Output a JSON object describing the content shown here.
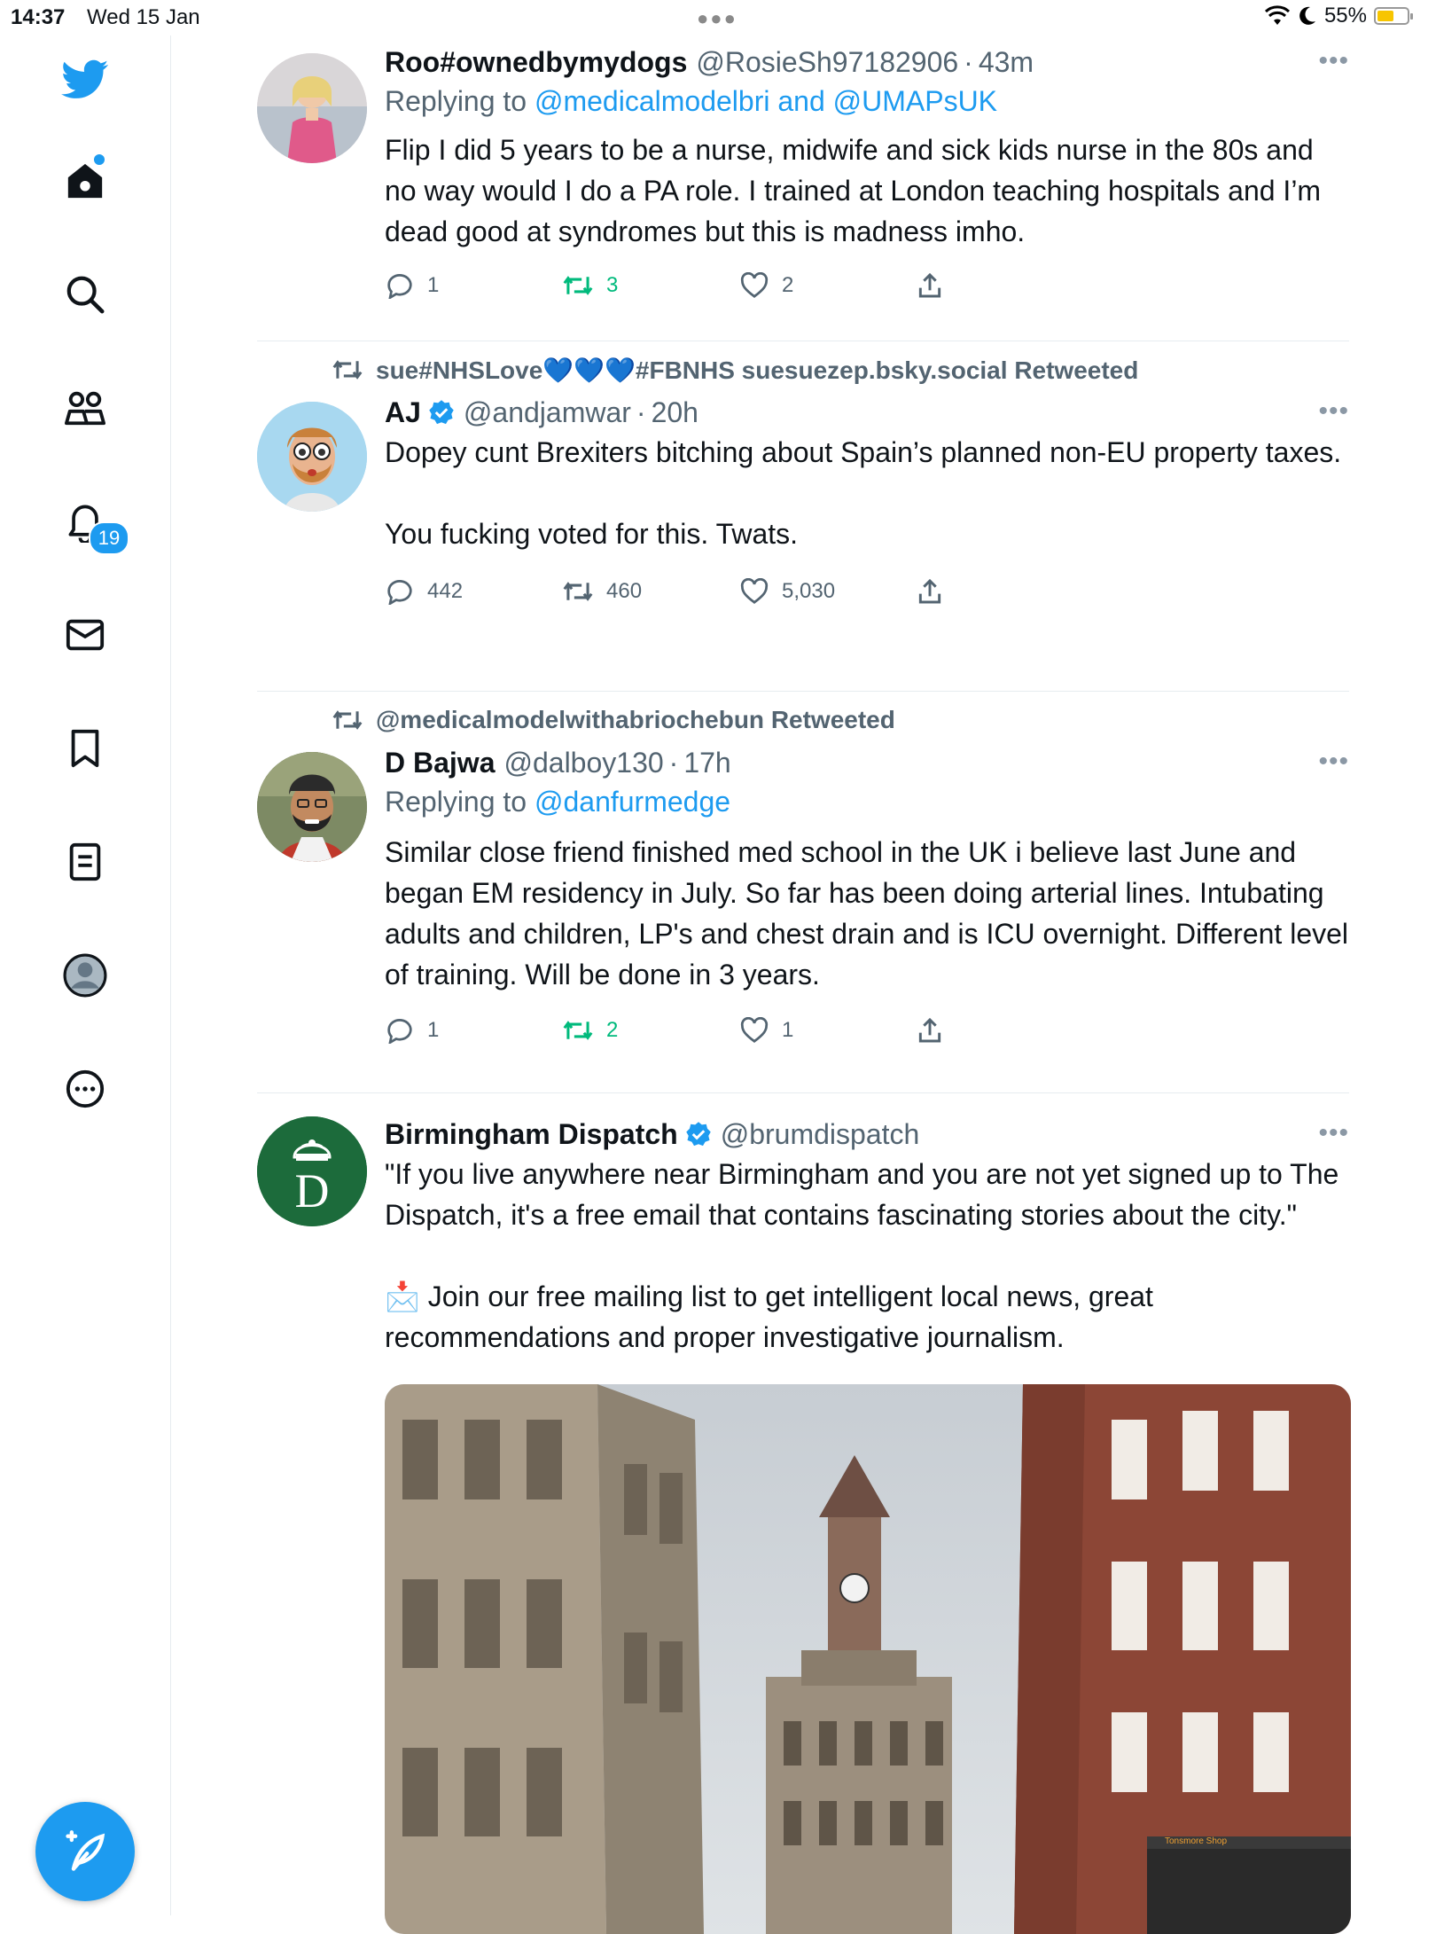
{
  "status_bar": {
    "time": "14:37",
    "date": "Wed 15 Jan",
    "battery": "55%",
    "battery_level": 0.55
  },
  "sidebar": {
    "items": [
      {
        "name": "twitter-logo"
      },
      {
        "name": "home"
      },
      {
        "name": "search"
      },
      {
        "name": "communities"
      },
      {
        "name": "notifications",
        "badge": "19"
      },
      {
        "name": "messages"
      },
      {
        "name": "bookmarks"
      },
      {
        "name": "lists"
      },
      {
        "name": "profile"
      },
      {
        "name": "more"
      }
    ],
    "accent": "#1d9bf0"
  },
  "tweets": [
    {
      "name": "Roo#ownedbymydogs",
      "handle": "@RosieSh97182906",
      "time": "43m",
      "replying_prefix": "Replying to ",
      "replying_to": "@medicalmodelbri and @UMAPsUK",
      "text": "Flip I did 5 years to be a nurse, midwife and sick kids nurse in the 80s and no way would I do a PA role. I trained at London teaching hospitals and I’m dead good at syndromes but this is madness imho.",
      "replies": "1",
      "retweets": "3",
      "likes": "2"
    },
    {
      "retweeted_by_pre": "sue#NHSLove",
      "retweeted_by_hearts": "💙💙💙",
      "retweeted_by_post": "#FBNHS suesuezep.bsky.social Retweeted",
      "name": "AJ",
      "handle": "@andjamwar",
      "time": "20h",
      "text": "Dopey cunt Brexiters bitching about Spain’s planned non-EU property taxes.\n\nYou fucking voted for this. Twats.",
      "replies": "442",
      "retweets": "460",
      "likes": "5,030"
    },
    {
      "retweeted_by": "@medicalmodelwithabriochebun Retweeted",
      "name": "D Bajwa",
      "handle": "@dalboy130",
      "time": "17h",
      "replying_prefix": "Replying to ",
      "replying_to": "@danfurmedge",
      "text": "Similar close friend finished med school in the UK i believe last June and began EM residency in July. So far has been doing arterial lines. Intubating adults and children, LP's and chest drain and is ICU overnight. Different level of training. Will be done in 3 years.",
      "replies": "1",
      "retweets": "2",
      "likes": "1"
    },
    {
      "name": "Birmingham Dispatch",
      "handle": "@brumdispatch",
      "avatar_letter": "D",
      "text": "\"If you live anywhere near Birmingham and you are not yet signed up to The Dispatch, it's a free email that contains fascinating stories about the city.\"\n\n📩 Join our free mailing list to get intelligent local news, great recommendations and proper investigative journalism.",
      "media_shop_sign": "Tonsmore Shop"
    }
  ]
}
